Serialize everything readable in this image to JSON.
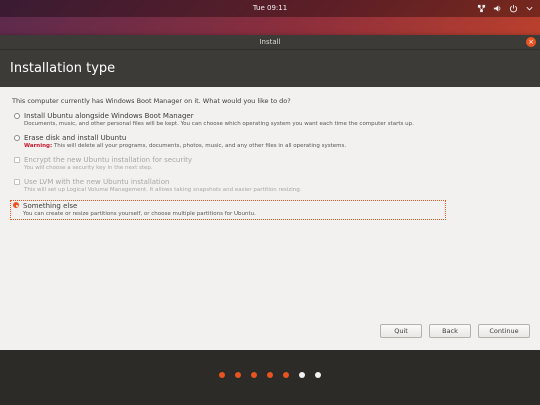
{
  "topbar": {
    "clock": "Tue 09:11"
  },
  "window": {
    "title": "Install",
    "header": "Installation type"
  },
  "question": "This computer currently has Windows Boot Manager on it. What would you like to do?",
  "options": [
    {
      "title": "Install Ubuntu alongside Windows Boot Manager",
      "desc": "Documents, music, and other personal files will be kept. You can choose which operating system you want each time the computer starts up."
    },
    {
      "title": "Erase disk and install Ubuntu",
      "warn": "Warning:",
      "desc": " This will delete all your programs, documents, photos, music, and any other files in all operating systems."
    },
    {
      "title": "Encrypt the new Ubuntu installation for security",
      "desc": "You will choose a security key in the next step."
    },
    {
      "title": "Use LVM with the new Ubuntu installation",
      "desc": "This will set up Logical Volume Management. It allows taking snapshots and easier partition resizing."
    },
    {
      "title": "Something else",
      "desc": "You can create or resize partitions yourself, or choose multiple partitions for Ubuntu."
    }
  ],
  "buttons": {
    "quit": "Quit",
    "back": "Back",
    "continue": "Continue"
  },
  "progress": {
    "steps_total": 7,
    "steps_done": 5
  }
}
